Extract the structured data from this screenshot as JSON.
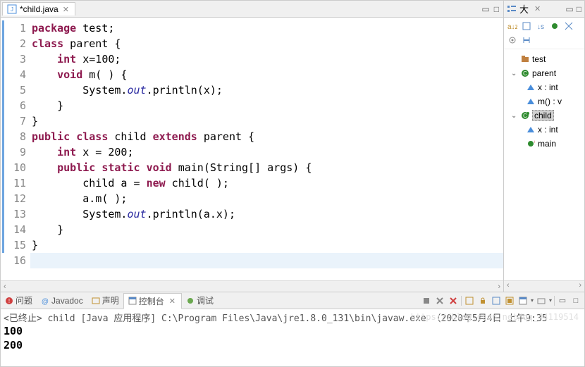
{
  "editor": {
    "tab_title": "*child.java",
    "lines": [
      {
        "n": 1,
        "mark": true,
        "tokens": [
          [
            "kw",
            "package"
          ],
          [
            "",
            ", "
          ],
          [
            "",
            "test;"
          ]
        ],
        "raw": "package test;",
        "html": "<span class='kw'>package</span> test;"
      },
      {
        "n": 2,
        "mark": true,
        "html": "<span class='kw'>class</span> parent {"
      },
      {
        "n": 3,
        "mark": true,
        "html": "    <span class='kw'>int</span> x=100;"
      },
      {
        "n": 4,
        "mark": true,
        "html": "    <span class='kw'>void</span> m( ) {"
      },
      {
        "n": 5,
        "mark": true,
        "html": "        System.<span class='it'>out</span>.println(x);"
      },
      {
        "n": 6,
        "mark": true,
        "html": "    }"
      },
      {
        "n": 7,
        "mark": true,
        "html": "}"
      },
      {
        "n": 8,
        "mark": true,
        "html": "<span class='kw'>public</span> <span class='kw'>class</span> child <span class='kw'>extends</span> parent {"
      },
      {
        "n": 9,
        "mark": true,
        "html": "    <span class='kw'>int</span> x = 200;"
      },
      {
        "n": 10,
        "mark": true,
        "html": "    <span class='kw'>public</span> <span class='kw'>static</span> <span class='kw'>void</span> main(String[] args) {"
      },
      {
        "n": 11,
        "mark": true,
        "html": "        child a = <span class='kw'>new</span> child( );"
      },
      {
        "n": 12,
        "mark": true,
        "html": "        a.m( );"
      },
      {
        "n": 13,
        "mark": true,
        "html": "        System.<span class='it'>out</span>.println(a.x);"
      },
      {
        "n": 14,
        "mark": true,
        "html": "    }"
      },
      {
        "n": 15,
        "mark": true,
        "html": "}"
      },
      {
        "n": 16,
        "mark": false,
        "html": "",
        "highlight": true
      }
    ]
  },
  "outline": {
    "tab_title": "大",
    "nodes": [
      {
        "level": 1,
        "arrow": "",
        "icon": "package-icon",
        "icon_color": "#c08040",
        "label": "test",
        "selected": false
      },
      {
        "level": 1,
        "arrow": "v",
        "icon": "class-icon",
        "icon_color": "#2e8b2e",
        "label": "parent",
        "selected": false
      },
      {
        "level": 2,
        "arrow": "",
        "icon": "field-icon",
        "icon_color": "#4a8edb",
        "label": "x : int",
        "selected": false,
        "shape": "tri"
      },
      {
        "level": 2,
        "arrow": "",
        "icon": "method-icon",
        "icon_color": "#4a8edb",
        "label": "m() : v",
        "selected": false,
        "shape": "tri"
      },
      {
        "level": 1,
        "arrow": "v",
        "icon": "class-icon",
        "icon_color": "#2e8b2e",
        "label": "child",
        "selected": true,
        "runnable": true
      },
      {
        "level": 2,
        "arrow": "",
        "icon": "field-icon",
        "icon_color": "#4a8edb",
        "label": "x : int",
        "selected": false,
        "shape": "tri"
      },
      {
        "level": 2,
        "arrow": "",
        "icon": "method-icon",
        "icon_color": "#2e8b2e",
        "label": "main",
        "selected": false,
        "shape": "circ",
        "static": true
      }
    ]
  },
  "bottom": {
    "tabs": {
      "problems": "问题",
      "javadoc": "Javadoc",
      "declaration": "声明",
      "console": "控制台",
      "debug": "调试"
    },
    "status": "<已终止> child [Java 应用程序] C:\\Program Files\\Java\\jre1.8.0_131\\bin\\javaw.exe （2020年5月4日 上午9:35",
    "output": [
      "100",
      "200"
    ],
    "watermark": "https://blog.csdn.net/qq_44119514"
  }
}
